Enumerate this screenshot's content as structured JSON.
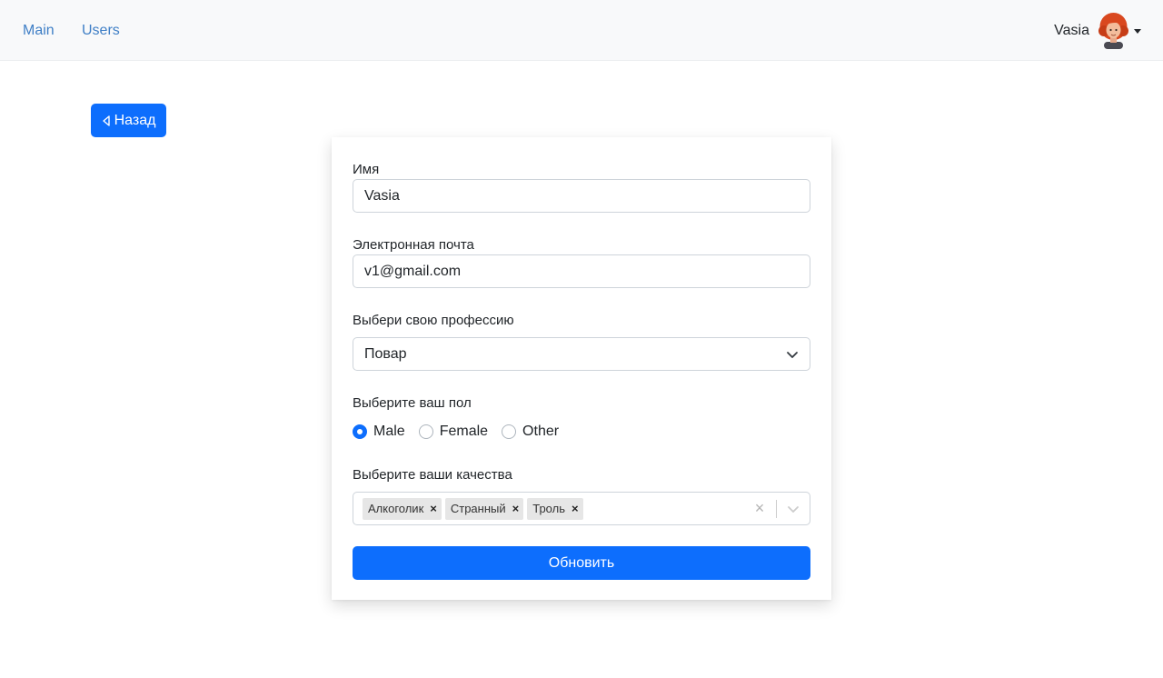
{
  "navbar": {
    "links": [
      {
        "label": "Main"
      },
      {
        "label": "Users"
      }
    ],
    "user": {
      "name": "Vasia"
    }
  },
  "back_button": {
    "label": "Назад",
    "icon": "caret-left-icon"
  },
  "form": {
    "name": {
      "label": "Имя",
      "value": "Vasia"
    },
    "email": {
      "label": "Электронная почта",
      "value": "v1@gmail.com"
    },
    "profession": {
      "label": "Выбери свою профессию",
      "value": "Повар"
    },
    "sex": {
      "label": "Выберите ваш пол",
      "options": [
        {
          "label": "Male",
          "checked": true
        },
        {
          "label": "Female",
          "checked": false
        },
        {
          "label": "Other",
          "checked": false
        }
      ]
    },
    "qualities": {
      "label": "Выберите ваши качества",
      "selected": [
        "Алкоголик",
        "Странный",
        "Троль"
      ]
    },
    "submit_label": "Обновить"
  },
  "colors": {
    "accent": "#0d6efd",
    "link": "#3f7fc6",
    "navbar_bg": "#f8f9fa"
  }
}
